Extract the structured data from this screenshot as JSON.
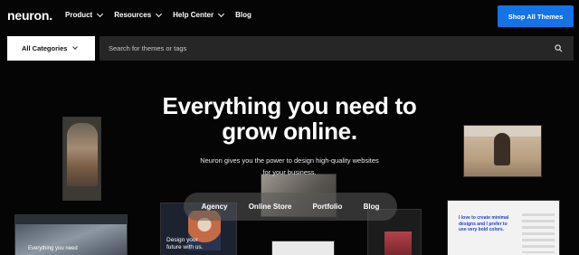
{
  "brand": {
    "logo": "neuron."
  },
  "nav": {
    "items": [
      {
        "label": "Product",
        "has_dropdown": true
      },
      {
        "label": "Resources",
        "has_dropdown": true
      },
      {
        "label": "Help Center",
        "has_dropdown": true
      },
      {
        "label": "Blog",
        "has_dropdown": false
      }
    ],
    "cta": "Shop All Themes"
  },
  "search": {
    "category_value": "All Categories",
    "placeholder": "Search for themes or tags",
    "icon": "search-icon"
  },
  "hero": {
    "title": "Everything you need to grow online.",
    "subtitle": "Neuron gives you the power to design high-quality websites for your business."
  },
  "filters": [
    "Agency",
    "Online Store",
    "Portfolio",
    "Blog"
  ],
  "previews": {
    "design_text": "Design your future with us.",
    "blue_headline": "I love to create minimal designs and I prefer to use very bold colors.",
    "building_text": "Everything you need"
  },
  "colors": {
    "accent": "#1473e6",
    "background": "#050505",
    "search_bg": "#262626"
  }
}
